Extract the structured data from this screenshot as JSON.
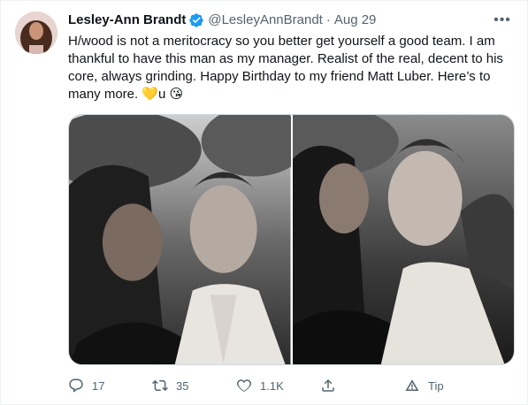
{
  "author": {
    "display_name": "Lesley-Ann Brandt",
    "handle": "@LesleyAnnBrandt",
    "separator": "·",
    "date": "Aug 29",
    "more_label": "•••"
  },
  "tweet": {
    "text": "H/wood is not a meritocracy so you better get yourself a good team. I am\nthankful to have this man as my manager. Realist of the real, decent to his\ncore, always grinding. Happy Birthday to my friend Matt Luber. Here’s to\nmany more. 💛u 😘"
  },
  "actions": {
    "reply_count": "17",
    "retweet_count": "35",
    "like_count": "1.1K",
    "share_label": "",
    "tip_label": "Tip"
  },
  "colors": {
    "verified": "#1d9bf0",
    "muted": "#536471",
    "text": "#0f1419"
  },
  "icons": [
    "verified-badge-icon",
    "more-icon",
    "reply-icon",
    "retweet-icon",
    "like-icon",
    "share-icon",
    "tip-icon"
  ]
}
